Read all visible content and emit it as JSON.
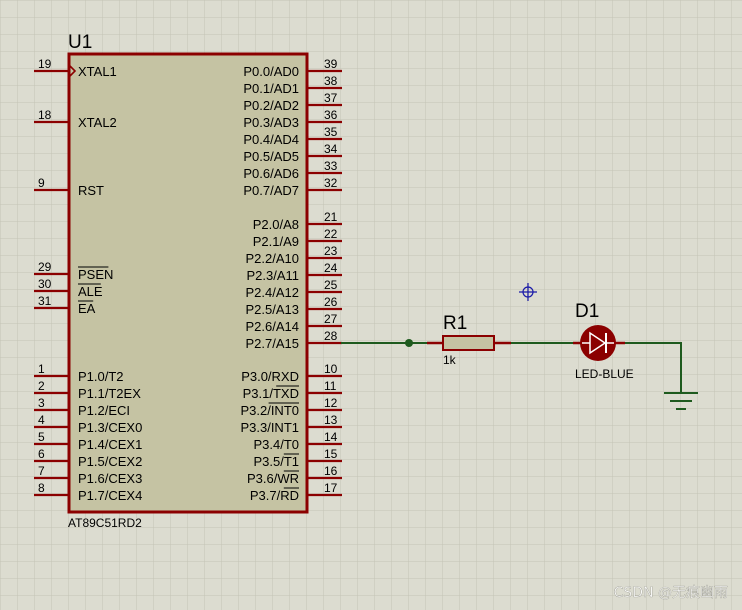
{
  "colors": {
    "background": "#dcdcd0",
    "grid": "#c4c4b6",
    "body_fill": "#c5c3a3",
    "component": "#8b0000",
    "wire": "#1e5a1e",
    "text": "#000000",
    "marker": "#1a1aa8"
  },
  "chip": {
    "ref": "U1",
    "part": "AT89C51RD2",
    "left_pins": [
      {
        "num": "19",
        "name": "XTAL1"
      },
      {
        "num": "18",
        "name": "XTAL2"
      },
      {
        "num": "9",
        "name": "RST"
      },
      {
        "num": "29",
        "name": "PSEN"
      },
      {
        "num": "30",
        "name": "ALE"
      },
      {
        "num": "31",
        "name": "EA"
      },
      {
        "num": "1",
        "name": "P1.0/T2"
      },
      {
        "num": "2",
        "name": "P1.1/T2EX"
      },
      {
        "num": "3",
        "name": "P1.2/ECI"
      },
      {
        "num": "4",
        "name": "P1.3/CEX0"
      },
      {
        "num": "5",
        "name": "P1.4/CEX1"
      },
      {
        "num": "6",
        "name": "P1.5/CEX2"
      },
      {
        "num": "7",
        "name": "P1.6/CEX3"
      },
      {
        "num": "8",
        "name": "P1.7/CEX4"
      }
    ],
    "right_pins": [
      {
        "num": "39",
        "name": "P0.0/AD0"
      },
      {
        "num": "38",
        "name": "P0.1/AD1"
      },
      {
        "num": "37",
        "name": "P0.2/AD2"
      },
      {
        "num": "36",
        "name": "P0.3/AD3"
      },
      {
        "num": "35",
        "name": "P0.4/AD4"
      },
      {
        "num": "34",
        "name": "P0.5/AD5"
      },
      {
        "num": "33",
        "name": "P0.6/AD6"
      },
      {
        "num": "32",
        "name": "P0.7/AD7"
      },
      {
        "num": "21",
        "name": "P2.0/A8"
      },
      {
        "num": "22",
        "name": "P2.1/A9"
      },
      {
        "num": "23",
        "name": "P2.2/A10"
      },
      {
        "num": "24",
        "name": "P2.3/A11"
      },
      {
        "num": "25",
        "name": "P2.4/A12"
      },
      {
        "num": "26",
        "name": "P2.5/A13"
      },
      {
        "num": "27",
        "name": "P2.6/A14"
      },
      {
        "num": "28",
        "name": "P2.7/A15"
      },
      {
        "num": "10",
        "name": "P3.0/RXD"
      },
      {
        "num": "11",
        "name": "P3.1/TXD"
      },
      {
        "num": "12",
        "name": "P3.2/INT0"
      },
      {
        "num": "13",
        "name": "P3.3/INT1"
      },
      {
        "num": "14",
        "name": "P3.4/T0"
      },
      {
        "num": "15",
        "name": "P3.5/T1"
      },
      {
        "num": "16",
        "name": "P3.6/WR"
      },
      {
        "num": "17",
        "name": "P3.7/RD"
      }
    ]
  },
  "resistor": {
    "ref": "R1",
    "value": "1k"
  },
  "led": {
    "ref": "D1",
    "part": "LED-BLUE"
  },
  "ground": {
    "symbol": "ground-icon"
  },
  "marker": {
    "symbol": "crosshair-icon"
  },
  "watermark": "CSDN @无痕幽雨"
}
